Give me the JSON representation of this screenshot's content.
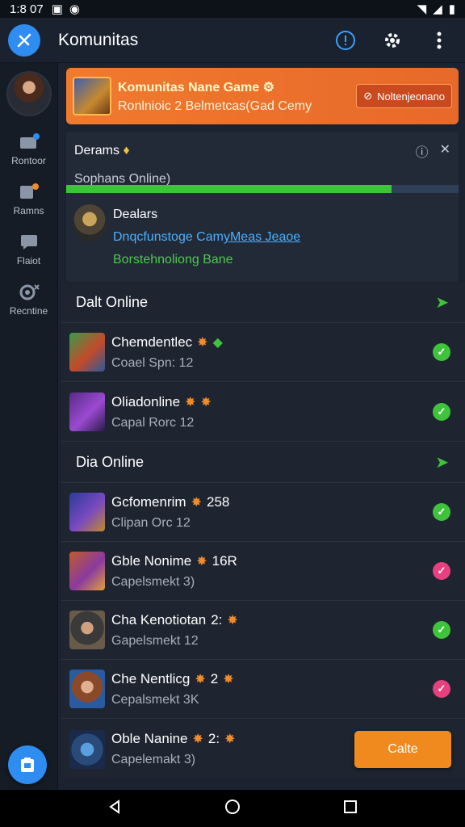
{
  "status_bar": {
    "time": "1:8 07"
  },
  "app_bar": {
    "title": "Komunitas",
    "icons": [
      "alert-icon",
      "gear-icon",
      "more-icon"
    ]
  },
  "sidebar": {
    "items": [
      {
        "label": "Rontoor",
        "icon": "window-icon"
      },
      {
        "label": "Ramns",
        "icon": "edit-icon"
      },
      {
        "label": "Flaiot",
        "icon": "chat-icon"
      },
      {
        "label": "Recntine",
        "icon": "eye-icon"
      }
    ]
  },
  "banner": {
    "title": "Komunitas Nane Game",
    "subtitle": "Ronlnioic 2 Belmetcas(Gad Cemy",
    "button": "Noltenjeonano"
  },
  "info_card": {
    "title": "Derams",
    "subtitle": "Sophans Online)",
    "progress": 0.83,
    "name": "Dealars",
    "link_text": "Dnqcfunstoge Cam",
    "link_underlined": "yMeas Jeaoe",
    "green_text": "Borstehnoliong Bane"
  },
  "sections": [
    {
      "title": "Dalt Online"
    },
    {
      "title": "Dia Online"
    }
  ],
  "rows": [
    {
      "name": "Chemdentlec",
      "suffix": "",
      "meta": "Coael Spn: 12",
      "status": "online"
    },
    {
      "name": "Oliadonline",
      "suffix": "",
      "meta": "Capal Rorc 12",
      "status": "online"
    },
    {
      "name": "Gcfomenrim",
      "suffix": "258",
      "meta": "Clipan Orc 12",
      "status": "online"
    },
    {
      "name": "Gble Nonime",
      "suffix": "16R",
      "meta": "Capelsmekt 3)",
      "status": "offline"
    },
    {
      "name": "Cha Kenotiotan",
      "suffix": "2:",
      "meta": "Gapelsmekt 12",
      "status": "online"
    },
    {
      "name": "Che Nentlicg",
      "suffix": "2",
      "meta": "Cepalsmekt 3K",
      "status": "offline"
    },
    {
      "name": "Oble Nanine",
      "suffix": "2:",
      "meta": "Capelemakt 3)",
      "status": "none"
    }
  ],
  "fab_call": {
    "label": "Calte"
  },
  "colors": {
    "accent": "#2f8cf0",
    "banner": "#f07a2e",
    "online": "#3ec43a",
    "offline": "#e8407e"
  }
}
